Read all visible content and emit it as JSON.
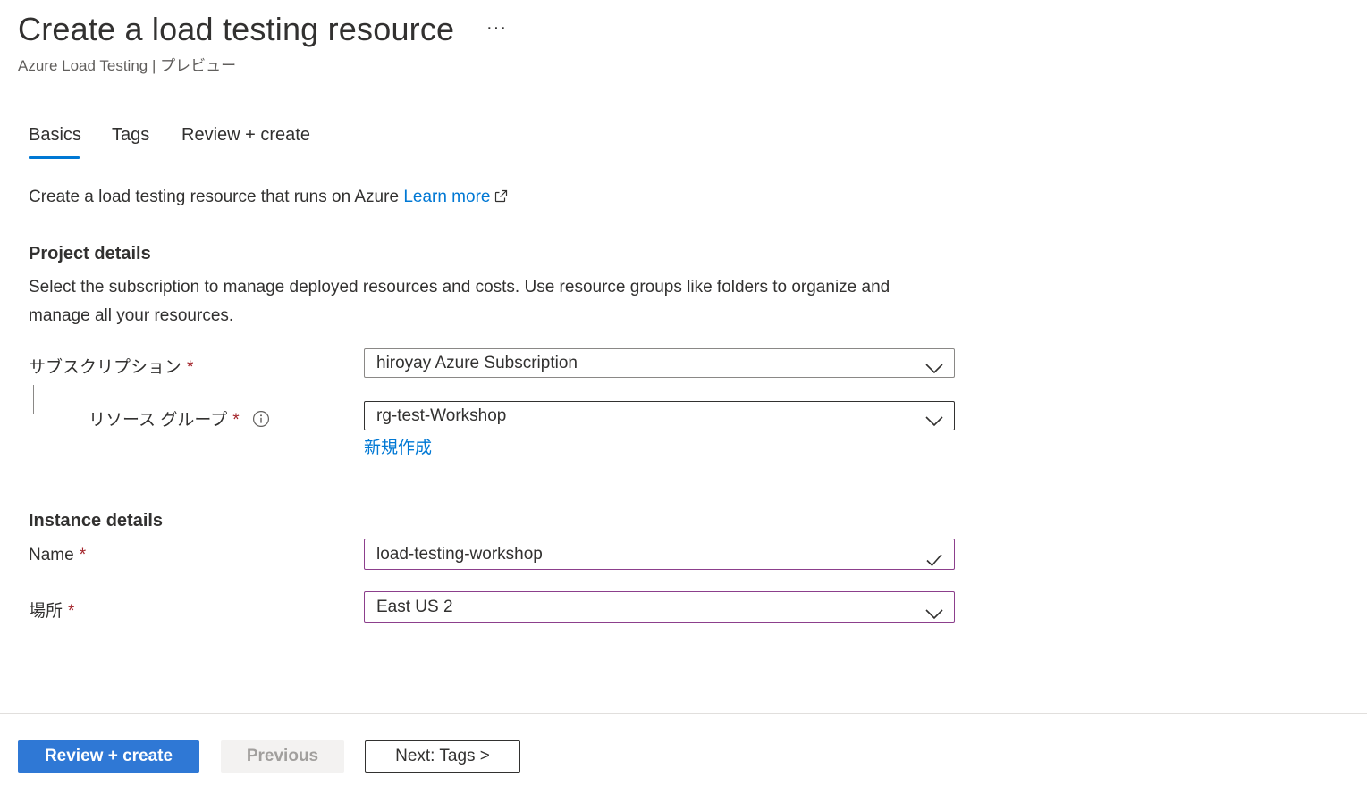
{
  "header": {
    "title": "Create a load testing resource",
    "more_label": "···",
    "subtitle": "Azure Load Testing | プレビュー"
  },
  "tabs": [
    {
      "label": "Basics",
      "selected": true
    },
    {
      "label": "Tags",
      "selected": false
    },
    {
      "label": "Review + create",
      "selected": false
    }
  ],
  "intro": {
    "text": "Create a load testing resource that runs on Azure",
    "learn_more": "Learn more"
  },
  "project": {
    "heading": "Project details",
    "description": "Select the subscription to manage deployed resources and costs. Use resource groups like folders to organize and manage all your resources.",
    "subscription_label": "サブスクリプション",
    "subscription_value": "hiroyay Azure Subscription",
    "resource_group_label": "リソース グループ",
    "resource_group_value": "rg-test-Workshop",
    "create_new": "新規作成"
  },
  "instance": {
    "heading": "Instance details",
    "name_label": "Name",
    "name_value": "load-testing-workshop",
    "location_label": "場所",
    "location_value": "East US 2"
  },
  "required_marker": "*",
  "footer": {
    "review_create": "Review + create",
    "previous": "Previous",
    "next": "Next: Tags >"
  },
  "colors": {
    "accent": "#0078d4",
    "primary_button": "#2f78d5",
    "required": "#a4262c",
    "validated_border": "#8c3f8c"
  }
}
